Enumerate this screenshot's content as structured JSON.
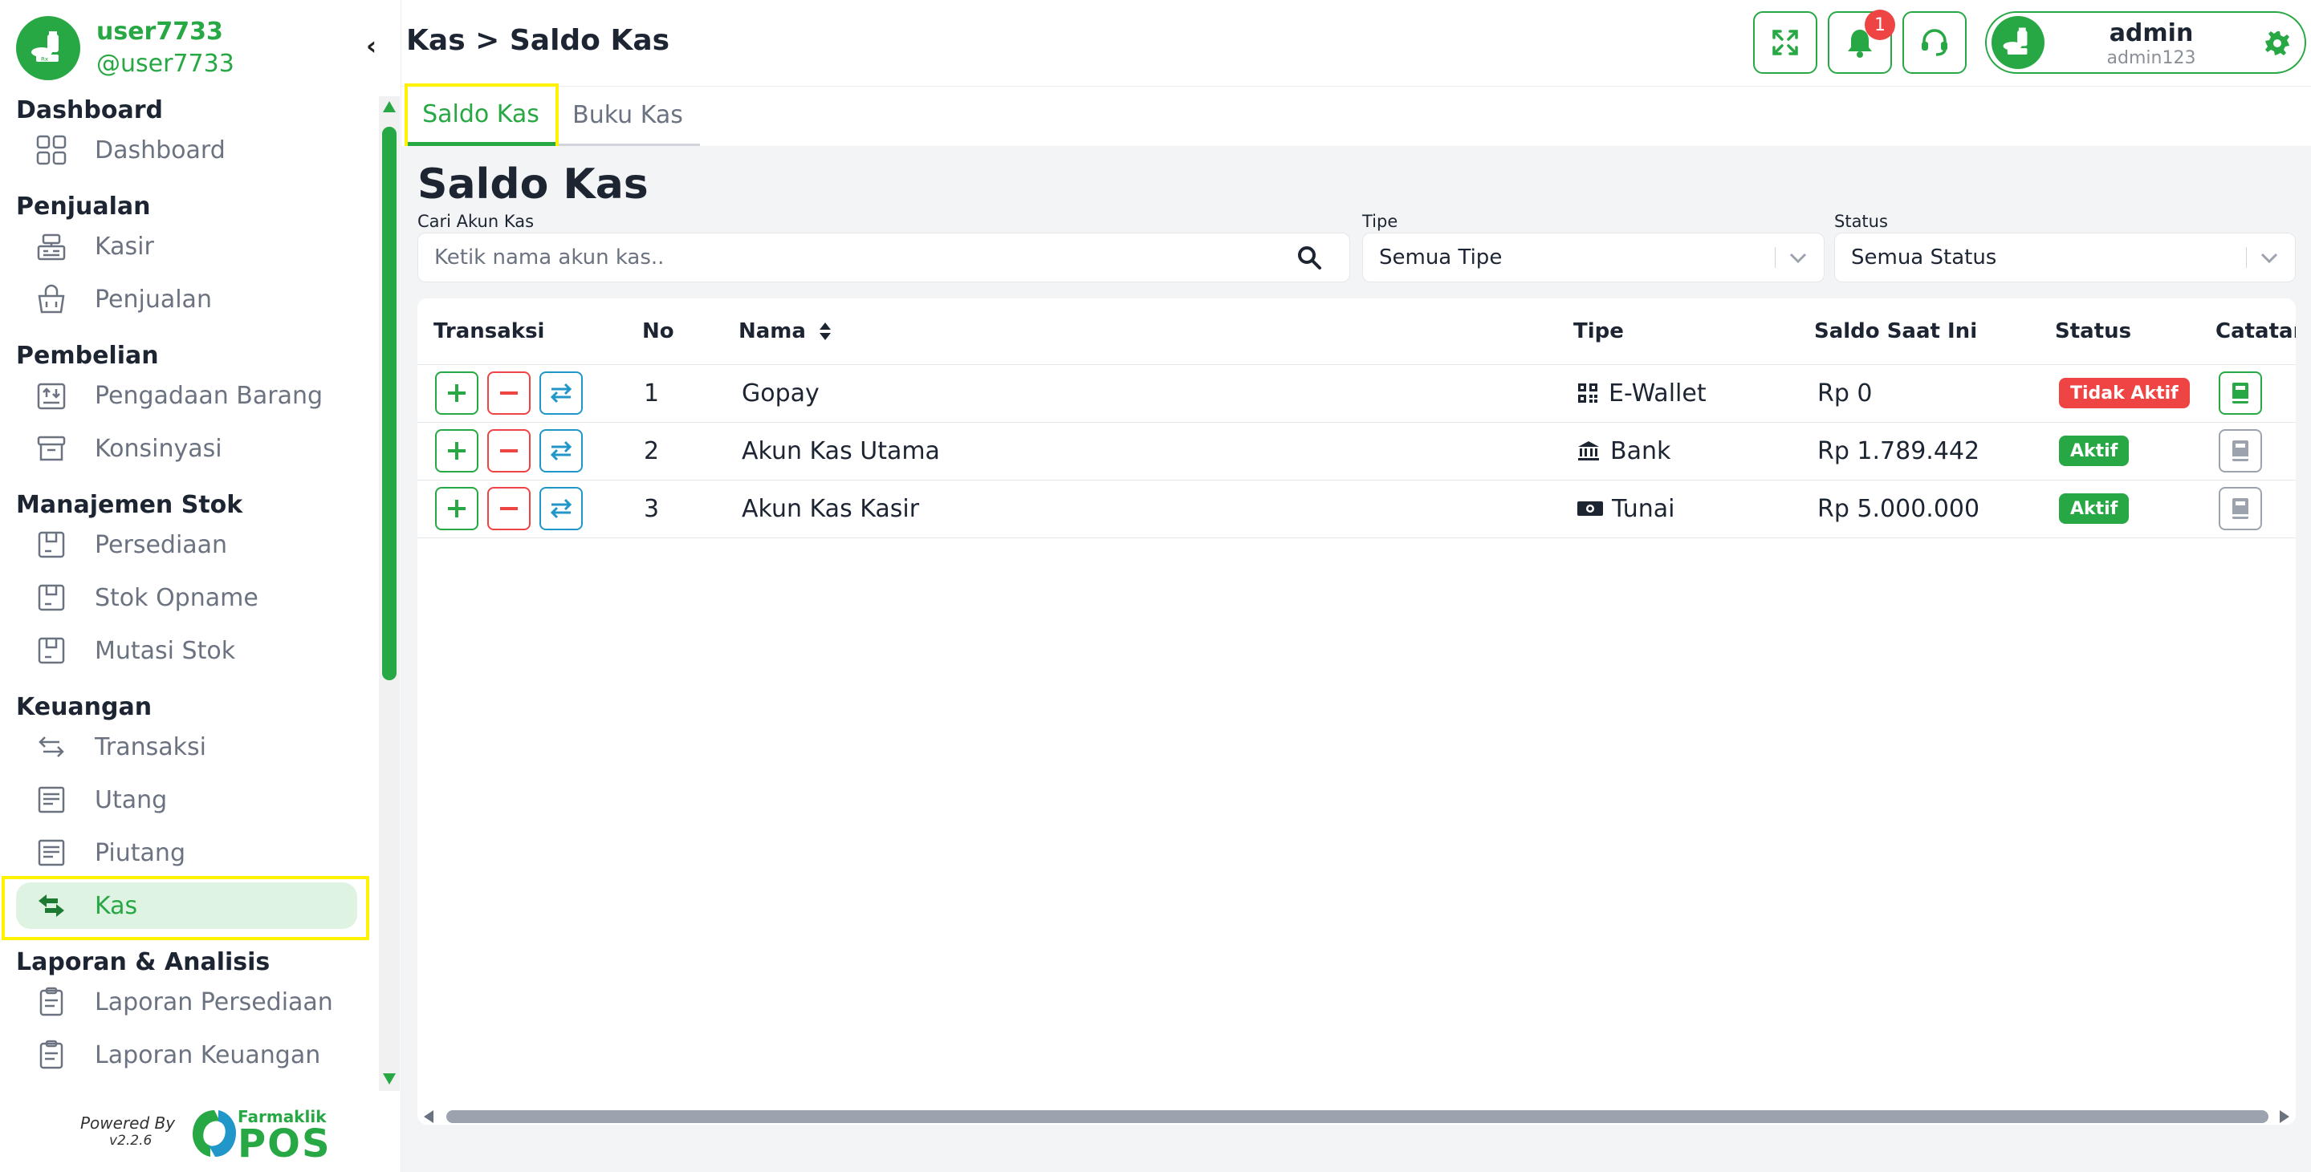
{
  "sidebar": {
    "user": {
      "name": "user7733",
      "handle": "@user7733"
    },
    "groups": [
      {
        "title": "Dashboard",
        "items": [
          {
            "label": "Dashboard",
            "icon": "dashboard-grid-icon"
          }
        ]
      },
      {
        "title": "Penjualan",
        "items": [
          {
            "label": "Kasir",
            "icon": "cash-register-icon"
          },
          {
            "label": "Penjualan",
            "icon": "shopping-basket-icon"
          }
        ]
      },
      {
        "title": "Pembelian",
        "items": [
          {
            "label": "Pengadaan Barang",
            "icon": "procurement-icon"
          },
          {
            "label": "Konsinyasi",
            "icon": "archive-box-icon"
          }
        ]
      },
      {
        "title": "Manajemen Stok",
        "items": [
          {
            "label": "Persediaan",
            "icon": "stock-box-icon"
          },
          {
            "label": "Stok Opname",
            "icon": "stock-box-icon"
          },
          {
            "label": "Mutasi Stok",
            "icon": "stock-box-icon"
          }
        ]
      },
      {
        "title": "Keuangan",
        "items": [
          {
            "label": "Transaksi",
            "icon": "transfer-arrows-icon"
          },
          {
            "label": "Utang",
            "icon": "receipt-icon"
          },
          {
            "label": "Piutang",
            "icon": "receipt-icon"
          },
          {
            "label": "Kas",
            "icon": "cash-exchange-icon",
            "active": true
          }
        ]
      },
      {
        "title": "Laporan & Analisis",
        "items": [
          {
            "label": "Laporan Persediaan",
            "icon": "clipboard-icon"
          },
          {
            "label": "Laporan Keuangan",
            "icon": "clipboard-icon"
          }
        ]
      }
    ],
    "footer": {
      "powered_by": "Powered By",
      "version": "v2.2.6",
      "brand_small": "Farmaklik",
      "brand_big": "POS"
    }
  },
  "header": {
    "breadcrumb": "Kas > Saldo Kas",
    "notification_count": "1",
    "user": {
      "name": "admin",
      "role": "admin123"
    }
  },
  "tabs": [
    {
      "label": "Saldo Kas",
      "active": true
    },
    {
      "label": "Buku Kas",
      "active": false
    }
  ],
  "main": {
    "title": "Saldo Kas",
    "filters": {
      "search": {
        "label": "Cari Akun Kas",
        "placeholder": "Ketik nama akun kas.."
      },
      "type": {
        "label": "Tipe",
        "value": "Semua Tipe"
      },
      "status": {
        "label": "Status",
        "value": "Semua Status"
      }
    },
    "table": {
      "columns": [
        "Transaksi",
        "No",
        "Nama",
        "Tipe",
        "Saldo Saat Ini",
        "Status",
        "Catatan"
      ],
      "rows": [
        {
          "no": "1",
          "nama": "Gopay",
          "tipe": "E-Wallet",
          "tipe_icon": "qr-code-icon",
          "saldo": "Rp 0",
          "status": "Tidak Aktif",
          "active": false
        },
        {
          "no": "2",
          "nama": "Akun Kas Utama",
          "tipe": "Bank",
          "tipe_icon": "bank-icon",
          "saldo": "Rp 1.789.442",
          "status": "Aktif",
          "active": true
        },
        {
          "no": "3",
          "nama": "Akun Kas Kasir",
          "tipe": "Tunai",
          "tipe_icon": "money-bill-icon",
          "saldo": "Rp 5.000.000",
          "status": "Aktif",
          "active": true
        }
      ]
    }
  },
  "colors": {
    "brand": "#27a844",
    "danger": "#ef4444",
    "info": "#2196c9",
    "highlight": "#fff200",
    "background": "#f3f4f6"
  }
}
